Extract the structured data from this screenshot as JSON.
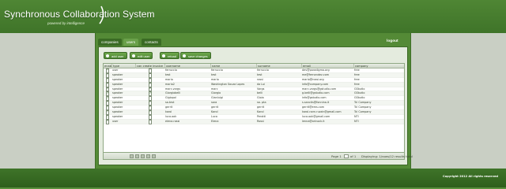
{
  "app": {
    "title": "Synchronous Collaboration System",
    "powered_by": "powered by intelligence"
  },
  "tabs": [
    {
      "label": "companies",
      "active": false
    },
    {
      "label": "users",
      "active": true
    },
    {
      "label": "contacts",
      "active": false
    }
  ],
  "logout_label": "logout",
  "toolbar": {
    "add_label": "add user",
    "edit_label": "edit user",
    "reload_label": "reload",
    "save_label": "save changes"
  },
  "grid": {
    "columns": [
      "enabled",
      "type",
      "can create invoice",
      "username",
      "name",
      "surname",
      "email",
      "company"
    ],
    "rows": [
      {
        "enabled": true,
        "type": "user",
        "invoice": false,
        "username": "ferruccio",
        "name": "ferruccio",
        "surname": "ferruccio",
        "email": "dev@paradigma.org",
        "company": "free"
      },
      {
        "enabled": true,
        "type": "speaker",
        "invoice": false,
        "username": "test",
        "name": "test",
        "surname": "test",
        "email": "me@fernandez.com",
        "company": "free"
      },
      {
        "enabled": true,
        "type": "speaker",
        "invoice": true,
        "username": "mario",
        "name": "mario",
        "surname": "rossi",
        "email": "mario@rossi.org",
        "company": "free"
      },
      {
        "enabled": true,
        "type": "speaker",
        "invoice": true,
        "username": "mario2",
        "name": "Washington Souza Lopes",
        "surname": "da Lui",
        "email": "info@company.com",
        "company": "free"
      },
      {
        "enabled": true,
        "type": "speaker",
        "invoice": true,
        "username": "marc.vargs",
        "name": "marc",
        "surname": "Vargs",
        "email": "marc.vargs@gstudio.com",
        "company": "GStudio"
      },
      {
        "enabled": true,
        "type": "speaker",
        "invoice": true,
        "username": "Giorgiobelli",
        "name": "Giorgio",
        "surname": "belli",
        "email": "g.belli@gstudio.com",
        "company": "GStudio"
      },
      {
        "enabled": true,
        "type": "speaker",
        "invoice": false,
        "username": "Gigiopol",
        "name": "Gianluigi",
        "surname": "Gioia",
        "email": "info@gstudio.com",
        "company": "GStudio"
      },
      {
        "enabled": true,
        "type": "speaker",
        "invoice": true,
        "username": "sa.test",
        "name": "sara",
        "surname": "sa. pta",
        "email": "s.sanctis@fonnina.it",
        "company": "Tcl Company"
      },
      {
        "enabled": true,
        "type": "speaker",
        "invoice": true,
        "username": "gerrit",
        "name": "gerrit",
        "surname": "gerrit",
        "email": "gerrit@ems.com",
        "company": "Tcl Company"
      },
      {
        "enabled": true,
        "type": "speaker",
        "invoice": true,
        "username": "karol",
        "name": "Karol",
        "surname": "Karol",
        "email": "karol.narn.ruzzin@gmail.com",
        "company": "Tcl Company"
      },
      {
        "enabled": true,
        "type": "speaker",
        "invoice": false,
        "username": "luca.ook",
        "name": "Luca",
        "surname": "Perotti",
        "email": "luca.ook@gmail.com",
        "company": "NTI"
      },
      {
        "enabled": true,
        "type": "user",
        "invoice": false,
        "username": "elena.rossi",
        "name": "Elena",
        "surname": "Rossi",
        "email": "lenna@orinock.it",
        "company": "NTI"
      }
    ]
  },
  "pager": {
    "page_prefix": "Page 1",
    "page_suffix": "of 1",
    "display_text": "Displaying: 1/rows/12 results total"
  },
  "footer": {
    "copyright": "Copyright 2012 All rights reserved"
  },
  "colors": {
    "brand_green": "#4f8634",
    "panel_bg": "#e4ebde",
    "band_gray": "#c9cfc4"
  }
}
